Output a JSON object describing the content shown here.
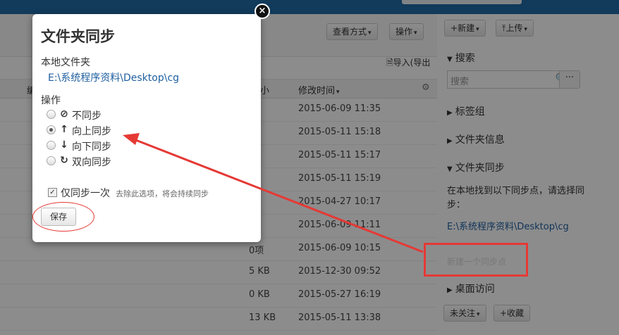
{
  "toolbar": {
    "view_mode": "查看方式",
    "actions": "操作",
    "import_export": "导入(导出"
  },
  "table": {
    "header_size": "小",
    "header_modified": "修改时间",
    "header_partial": "编",
    "rows": [
      {
        "size": "项",
        "time": "2015-06-09 11:35"
      },
      {
        "size": "项",
        "time": "2015-05-11 15:18"
      },
      {
        "size": "项",
        "time": "2015-05-11 15:17"
      },
      {
        "size": "项",
        "time": "2015-05-11 15:19"
      },
      {
        "size": "项",
        "time": "2015-04-27 10:17"
      },
      {
        "size": "项",
        "time": "2015-06-09 11:11"
      },
      {
        "size": "0项",
        "time": "2015-06-09 10:15"
      },
      {
        "size": "5 KB",
        "time": "2015-12-30 09:52"
      },
      {
        "size": "0 KB",
        "time": "2015-05-27 16:19"
      },
      {
        "size": "13 KB",
        "time": "2015-05-11 13:38"
      }
    ]
  },
  "sidebar": {
    "new_btn": "新建",
    "upload_btn": "上传",
    "search_heading": "搜索",
    "search_placeholder": "搜索",
    "more_btn": "···",
    "tags_heading": "标签组",
    "folder_info_heading": "文件夹信息",
    "folder_sync_heading": "文件夹同步",
    "sync_found_text_1": "在本地找到以下同步点，请选择同",
    "sync_found_text_2": "步：",
    "sync_path": "E:\\系统程序资料\\Desktop\\cg",
    "new_sync_point": "新建一个同步点",
    "desktop_access_heading": "桌面访问",
    "unfollow_btn": "未关注",
    "favorite_btn": "+收藏"
  },
  "modal": {
    "title": "文件夹同步",
    "local_folder_label": "本地文件夹",
    "local_folder_path": "E:\\系统程序资料\\Desktop\\cg",
    "operation_label": "操作",
    "options": [
      {
        "label": "不同步",
        "icon": "ban-icon",
        "glyph": "⊘",
        "selected": false
      },
      {
        "label": "向上同步",
        "icon": "arrow-up-icon",
        "glyph": "↑",
        "selected": true
      },
      {
        "label": "向下同步",
        "icon": "arrow-down-icon",
        "glyph": "↓",
        "selected": false
      },
      {
        "label": "双向同步",
        "icon": "refresh-icon",
        "glyph": "↻",
        "selected": false
      }
    ],
    "sync_once_label": "仅同步一次",
    "sync_once_hint": "去除此选项，将会持续同步",
    "save_btn": "保存",
    "close_glyph": "×"
  },
  "colors": {
    "annotation_red": "#e53935",
    "link_blue": "#1f5fa0",
    "topbar": "#1f6aa6"
  }
}
